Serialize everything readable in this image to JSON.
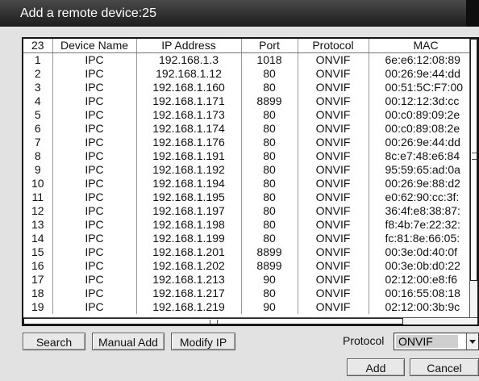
{
  "dialog": {
    "title": "Add a remote device:25"
  },
  "table": {
    "headers": {
      "count": "23",
      "name": "Device Name",
      "ip": "IP Address",
      "port": "Port",
      "protocol": "Protocol",
      "mac": "MAC"
    },
    "rows": [
      {
        "n": "1",
        "name": "IPC",
        "ip": "192.168.1.3",
        "port": "1018",
        "protocol": "ONVIF",
        "mac": "6e:e6:12:08:89"
      },
      {
        "n": "2",
        "name": "IPC",
        "ip": "192.168.1.12",
        "port": "80",
        "protocol": "ONVIF",
        "mac": "00:26:9e:44:dd"
      },
      {
        "n": "3",
        "name": "IPC",
        "ip": "192.168.1.160",
        "port": "80",
        "protocol": "ONVIF",
        "mac": "00:51:5C:F7:00"
      },
      {
        "n": "4",
        "name": "IPC",
        "ip": "192.168.1.171",
        "port": "8899",
        "protocol": "ONVIF",
        "mac": "00:12:12:3d:cc"
      },
      {
        "n": "5",
        "name": "IPC",
        "ip": "192.168.1.173",
        "port": "80",
        "protocol": "ONVIF",
        "mac": "00:c0:89:09:2e"
      },
      {
        "n": "6",
        "name": "IPC",
        "ip": "192.168.1.174",
        "port": "80",
        "protocol": "ONVIF",
        "mac": "00:c0:89:08:2e"
      },
      {
        "n": "7",
        "name": "IPC",
        "ip": "192.168.1.176",
        "port": "80",
        "protocol": "ONVIF",
        "mac": "00:26:9e:44:dd"
      },
      {
        "n": "8",
        "name": "IPC",
        "ip": "192.168.1.191",
        "port": "80",
        "protocol": "ONVIF",
        "mac": "8c:e7:48:e6:84"
      },
      {
        "n": "9",
        "name": "IPC",
        "ip": "192.168.1.192",
        "port": "80",
        "protocol": "ONVIF",
        "mac": "95:59:65:ad:0a"
      },
      {
        "n": "10",
        "name": "IPC",
        "ip": "192.168.1.194",
        "port": "80",
        "protocol": "ONVIF",
        "mac": "00:26:9e:88:d2"
      },
      {
        "n": "11",
        "name": "IPC",
        "ip": "192.168.1.195",
        "port": "80",
        "protocol": "ONVIF",
        "mac": "e0:62:90:cc:3f:"
      },
      {
        "n": "12",
        "name": "IPC",
        "ip": "192.168.1.197",
        "port": "80",
        "protocol": "ONVIF",
        "mac": "36:4f:e8:38:87:"
      },
      {
        "n": "13",
        "name": "IPC",
        "ip": "192.168.1.198",
        "port": "80",
        "protocol": "ONVIF",
        "mac": "f8:4b:7e:22:32:"
      },
      {
        "n": "14",
        "name": "IPC",
        "ip": "192.168.1.199",
        "port": "80",
        "protocol": "ONVIF",
        "mac": "fc:81:8e:66:05:"
      },
      {
        "n": "15",
        "name": "IPC",
        "ip": "192.168.1.201",
        "port": "8899",
        "protocol": "ONVIF",
        "mac": "00:3e:0d:40:0f"
      },
      {
        "n": "16",
        "name": "IPC",
        "ip": "192.168.1.202",
        "port": "8899",
        "protocol": "ONVIF",
        "mac": "00:3e:0b:d0:22"
      },
      {
        "n": "17",
        "name": "IPC",
        "ip": "192.168.1.213",
        "port": "90",
        "protocol": "ONVIF",
        "mac": "02:12:00:e8:f6"
      },
      {
        "n": "18",
        "name": "IPC",
        "ip": "192.168.1.217",
        "port": "80",
        "protocol": "ONVIF",
        "mac": "00:16:55:08:18"
      },
      {
        "n": "19",
        "name": "IPC",
        "ip": "192.168.1.219",
        "port": "90",
        "protocol": "ONVIF",
        "mac": "02:12:00:3b:9c"
      }
    ]
  },
  "buttons": {
    "search": "Search",
    "manual_add": "Manual Add",
    "modify_ip": "Modify IP",
    "add": "Add",
    "cancel": "Cancel"
  },
  "protocol_filter": {
    "label": "Protocol",
    "selected": "ONVIF"
  },
  "icons": {
    "dropdown": "chevron-down-icon"
  },
  "colors": {
    "titlebar": "#1c1c1c",
    "dialog_bg": "#e2e2e2",
    "selected_value_bg": "#cfcfcf"
  }
}
